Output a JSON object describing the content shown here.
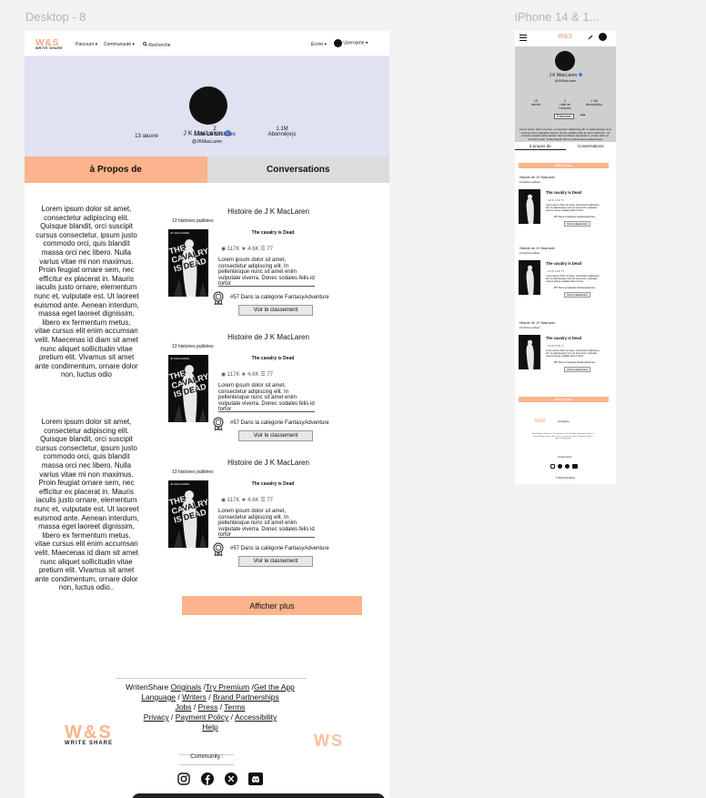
{
  "frames": {
    "desktop_label": "Desktop - 8",
    "phone_label": "iPhone 14 & 1..."
  },
  "nav": {
    "logo": "W&S",
    "logo_sub": "WRITE  SHARE",
    "items": [
      "Parcourir ▾",
      "Communauté ▾",
      "Recherche"
    ],
    "write": "Écrire ▾",
    "username": "Username ▾"
  },
  "profile": {
    "name": "J K MacLaren",
    "handle": "@JKMacLaren",
    "stats": [
      {
        "value": "",
        "label": "13 œuvre"
      },
      {
        "value": "2",
        "label": "Liste de Lectures"
      },
      {
        "value": "1.1M",
        "label": "Abonné(e)s"
      }
    ]
  },
  "tabs": {
    "about": "à Propos de",
    "conversations": "Conversations"
  },
  "about": {
    "p1": "Lorem ipsum dolor sit amet, consectetur adipiscing elit. Quisque blandit, orci suscipit cursus consectetur, ipsum justo commodo orci, quis blandit massa orci nec libero. Nulla varius vitae mi non maximus. Proin feugiat ornare sem, nec efficitur ex placerat in. Mauris iaculis justo ornare, elementum nunc et, vulputate est. Ut laoreet euismod ante. Aenean interdum, massa eget laoreet dignissim, libero ex fermentum metus, vitae cursus elit enim accumsan velit. Maecenas id diam sit amet nunc aliquet sollicitudin vitae pretium elit. Vivamus sit amet ante condimentum, ornare dolor non, luctus odio",
    "p2": "Lorem ipsum dolor sit amet, consectetur adipiscing elit. Quisque blandit, orci suscipit cursus consectetur, ipsum justo commodo orci, quis blandit massa orci nec libero. Nulla varius vitae mi non maximus. Proin feugiat ornare sem, nec efficitur ex placerat in. Mauris iaculis justo ornare, elementum nunc et, vulputate est. Ut laoreet euismod ante. Aenean interdum, massa eget laoreet dignissim, libero ex fermentum metus, vitae cursus elit enim accumsan velit. Maecenas id diam sit amet nunc aliquet sollicitudin vitae pretium elit. Vivamus sit amet ante condimentum, ornare dolor non, luctus odio.."
  },
  "stories": [
    {
      "heading": "Histoire de J K MacLaren",
      "published": "13 histoires publiées",
      "title": "The cavalry is Dead",
      "cover_text": "THE CAVALRY IS DEAD",
      "cover_author": "JK MACLAREN",
      "views": "117K",
      "stars": "4.6K",
      "parts": "77",
      "desc": "Lorem ipsum dolor sit amet, consectetur adipiscing elit. In pellentesque nunc sit amet enim vulputate viverra. Donec sodales felis id tortor",
      "rank": "#57 Dans la catégorie FantasyAdventure",
      "rank_btn": "Voir le classement"
    },
    {
      "heading": "Histoire de J K MacLaren",
      "published": "13 histoires publiées",
      "title": "The cavalry is Dead",
      "cover_text": "THE CAVALRY IS DEAD",
      "cover_author": "JK MACLAREN",
      "views": "117K",
      "stars": "4.6K",
      "parts": "77",
      "desc": "Lorem ipsum dolor sit amet, consectetur adipiscing elit. In pellentesque nunc sit amet enim vulputate viverra. Donec sodales felis id tortor",
      "rank": "#57 Dans la catégorie FantasyAdventure",
      "rank_btn": "Voir le classement"
    },
    {
      "heading": "Histoire de J K MacLaren",
      "published": "13 histoires publiées",
      "title": "The cavalry is Dead",
      "cover_text": "THE CAVALRY IS DEAD",
      "cover_author": "JK MACLAREN",
      "views": "117K",
      "stars": "4.6K",
      "parts": "77",
      "desc": "Lorem ipsum dolor sit amet, consectetur adipiscing elit. In pellentesque nunc sit amet enim vulputate viverra. Donec sodales felis id tortor",
      "rank": "#57 Dans la catégorie FantasyAdventure",
      "rank_btn": "Voir le classement"
    }
  ],
  "more_btn": "Afficher plus",
  "footer": {
    "line1_a": "WritenShare",
    "line1_b": "Originals",
    "line1_c": "Try Premium",
    "line1_d": "Get the App",
    "line2_a": "Language",
    "line2_b": "Writers",
    "line2_c": "Brand Partnerships",
    "line3_a": "Jobs",
    "line3_b": "Press",
    "line3_c": "Terms",
    "line4_a": "Privacy",
    "line4_b": "Payment Policy",
    "line4_c": "Accessibility",
    "line5": "Help",
    "community": "Community :",
    "logo_big": "W&S",
    "logo_big_sub": "WRITE    SHARE",
    "logo_right": "WS"
  },
  "phone": {
    "name": "J K MacLaren",
    "handle": "@JKMacLaren",
    "stats": [
      {
        "value": "13",
        "label": "œuvre"
      },
      {
        "value": "2",
        "label": "Liste de Lectures"
      },
      {
        "value": "1.1M",
        "label": "Abonné(e)s"
      }
    ],
    "follow_btn": "S'abonner",
    "tab_about": "à propos de",
    "tab_conv": "Conversations",
    "about": "Lorem ipsum dolor sit amet, consectetur adipiscing elit. In pellentesque nunc sit amet enim vulputate viverra. Donec sodales felis id tortor maximus, vel aenean suspicit tellus iaculis. Sed ut ultrices elementum, ornare dolor et, tincidunt diam. Nulla blandit velit in pellentesque pellentesque",
    "more": "Afficher plus",
    "stories": [
      {
        "heading": "Histoire de J K MacLaren",
        "published": "13 histoires publiées",
        "title": "The cavalry is Dead"
      },
      {
        "heading": "Histoire de J K MacLaren",
        "published": "13 histoires publiées",
        "title": "The cavalry is Dead"
      },
      {
        "heading": "Histoire de J K MacLaren",
        "published": "13 histoires publiées",
        "title": "The cavalry is Dead"
      }
    ],
    "company": "Company",
    "community": "Community :",
    "copyright": "© 2024 WritnShare"
  },
  "colors": {
    "accent": "#fcb48c",
    "hero": "#e0e2f2",
    "tab_inactive": "#dcdcdc"
  }
}
